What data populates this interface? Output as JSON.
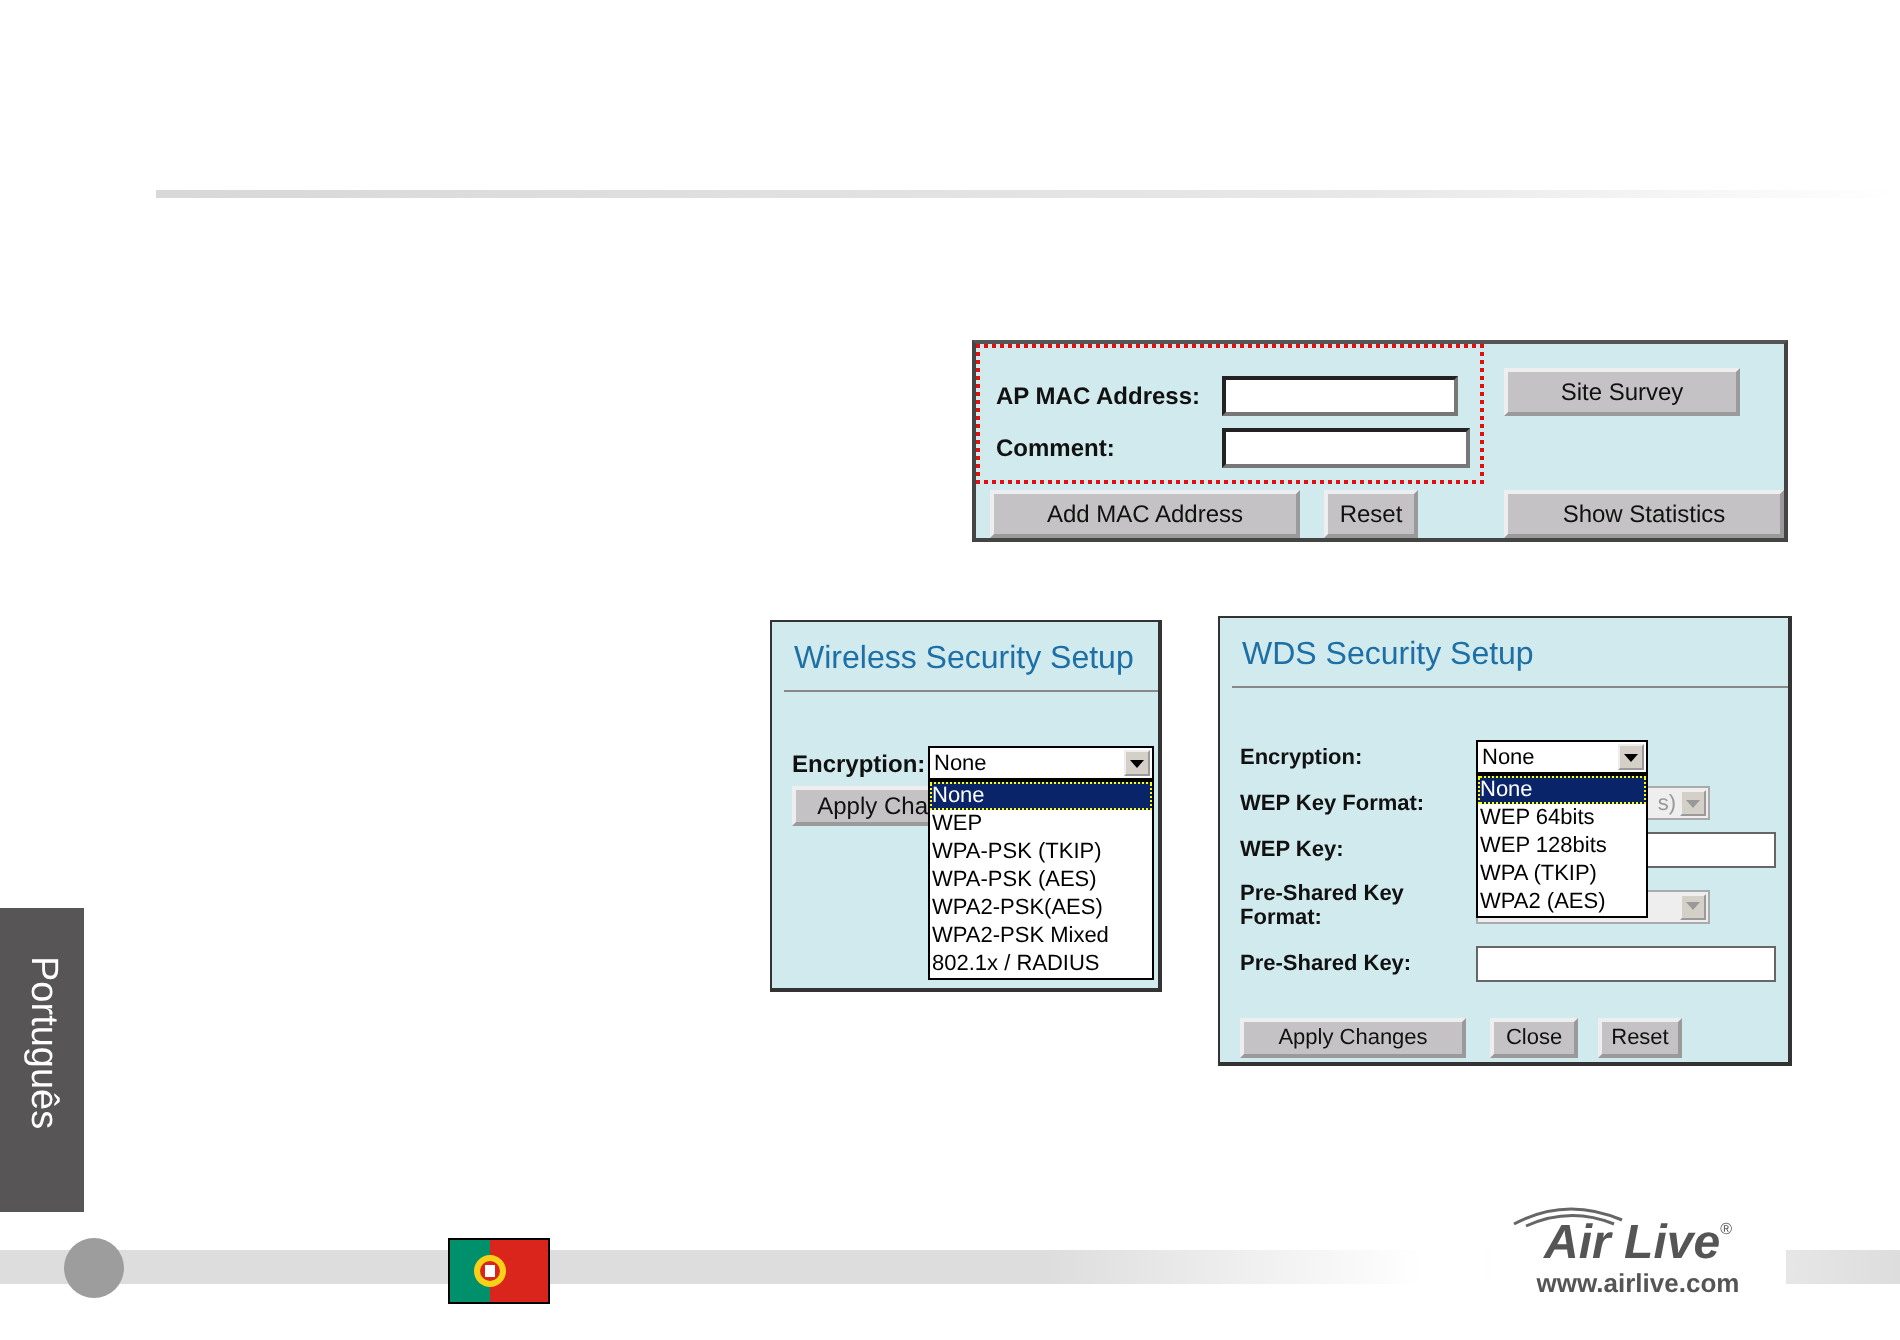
{
  "mac_panel": {
    "fields": [
      {
        "label": "AP MAC Address:"
      },
      {
        "label": "Comment:"
      }
    ],
    "side_button": "Site Survey",
    "buttons": [
      "Add MAC Address",
      "Reset",
      "Show Statistics"
    ]
  },
  "wireless_security": {
    "title": "Wireless Security Setup",
    "encryption": {
      "label": "Encryption:",
      "value": "None",
      "open": true,
      "options": [
        {
          "label": "None",
          "selected": true
        },
        {
          "label": "WEP",
          "selected": false
        },
        {
          "label": "WPA-PSK (TKIP)",
          "selected": false
        },
        {
          "label": "WPA-PSK (AES)",
          "selected": false
        },
        {
          "label": "WPA2-PSK(AES)",
          "selected": false
        },
        {
          "label": "WPA2-PSK Mixed",
          "selected": false
        },
        {
          "label": "802.1x / RADIUS",
          "selected": false
        }
      ]
    },
    "buttons": [
      "Apply Cha"
    ]
  },
  "wds_security": {
    "title": "WDS Security Setup",
    "rows": [
      {
        "kind": "select",
        "label": "Encryption:",
        "value": "None",
        "disabled": false,
        "open": true,
        "options": [
          {
            "label": "None",
            "selected": true
          },
          {
            "label": "WEP 64bits",
            "selected": false
          },
          {
            "label": "WEP 128bits",
            "selected": false
          },
          {
            "label": "WPA (TKIP)",
            "selected": false
          },
          {
            "label": "WPA2 (AES)",
            "selected": false
          }
        ]
      },
      {
        "kind": "select",
        "label": "WEP Key Format:",
        "value": "s)",
        "disabled": true,
        "open": false
      },
      {
        "kind": "text",
        "label": "WEP Key:"
      },
      {
        "kind": "select",
        "label": "Pre-Shared Key Format:",
        "disabled": true,
        "open": false
      },
      {
        "kind": "text",
        "label": "Pre-Shared Key:"
      }
    ],
    "buttons": [
      "Apply Changes",
      "Close",
      "Reset"
    ]
  },
  "side_tab": {
    "label": "Português"
  },
  "footer": {
    "logo": "Air Live",
    "logo_mark": "®",
    "url": "www.airlive.com"
  }
}
